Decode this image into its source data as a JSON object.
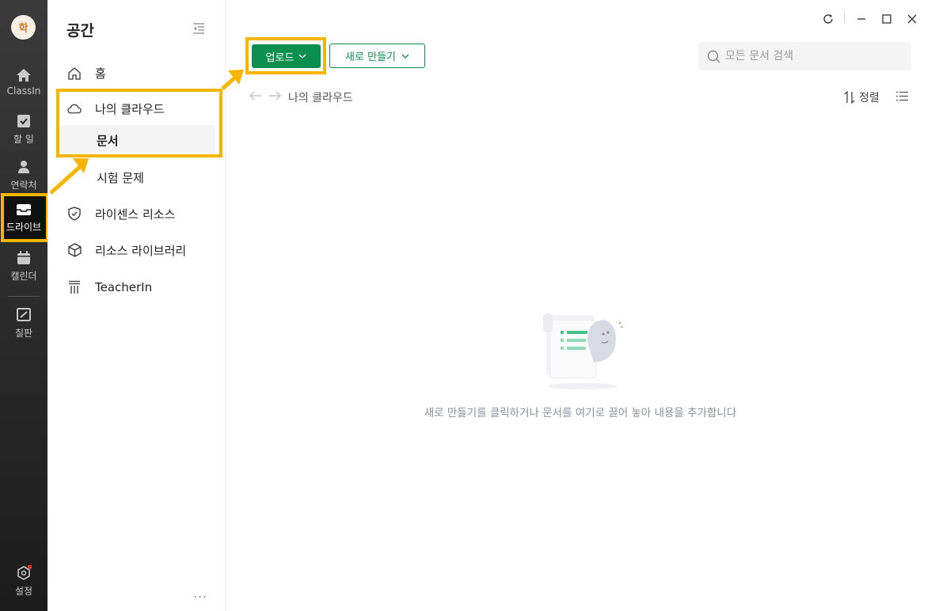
{
  "rail": {
    "avatar_text": "학",
    "items": [
      {
        "label": "ClassIn"
      },
      {
        "label": "할 일"
      },
      {
        "label": "연락처"
      },
      {
        "label": "드라이브"
      },
      {
        "label": "캘린더"
      },
      {
        "label": "칠판"
      },
      {
        "label": "설정"
      }
    ]
  },
  "sidebar": {
    "title": "공간",
    "items": [
      {
        "label": "홈"
      },
      {
        "label": "나의 클라우드"
      },
      {
        "label": "문서"
      },
      {
        "label": "시험 문제"
      },
      {
        "label": "라이센스 리소스"
      },
      {
        "label": "리소스 라이브러리"
      },
      {
        "label": "TeacherIn"
      }
    ],
    "more": "..."
  },
  "toolbar": {
    "upload_label": "업로드",
    "new_label": "새로 만들기"
  },
  "search": {
    "placeholder": "모든 문서 검색"
  },
  "breadcrumb": {
    "current": "나의 클라우드"
  },
  "sort_label": "정렬",
  "empty_message": "새로 만들기를 클릭하거나 문서를 여기로 끌어 놓아 내용을 추가합니다",
  "colors": {
    "accent": "#0a8f4e",
    "highlight": "#f7b500",
    "rail_bg": "#2b2b2b"
  }
}
